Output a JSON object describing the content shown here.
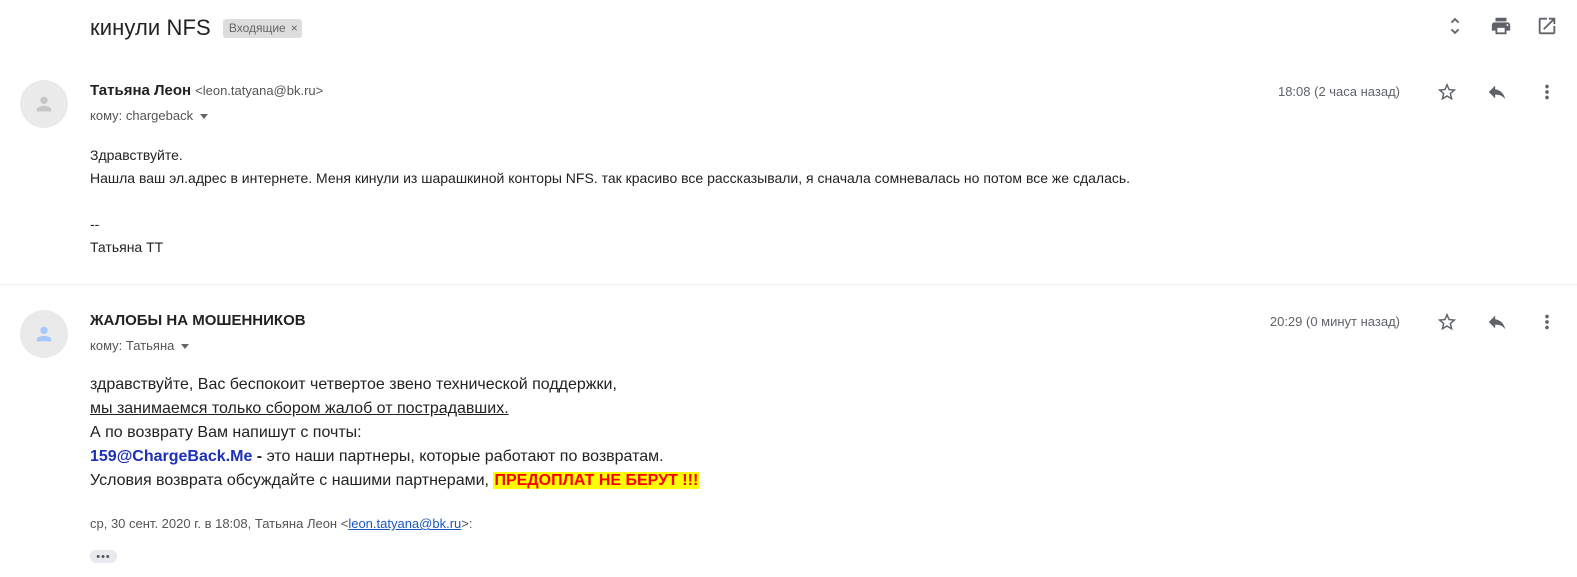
{
  "thread": {
    "subject": "кинули NFS",
    "label": "Входящие",
    "label_remove": "×",
    "top_icons": [
      "expand-collapse-icon",
      "print-icon",
      "open-in-new-window-icon"
    ]
  },
  "messages": [
    {
      "sender_name": "Татьяна Леон",
      "sender_email": "<leon.tatyana@bk.ru>",
      "to": "кому: chargeback",
      "date": "18:08 (2 часа назад)",
      "body": {
        "greeting": "Здравствуйте.",
        "line": "Нашла ваш эл.адрес в интернете. Меня кинули из шарашкиной конторы NFS. так красиво все рассказывали, я сначала сомневалась но потом все же сдалась.",
        "sig_sep": "--",
        "signature": "Татьяна ТТ"
      }
    },
    {
      "sender_name": "ЖАЛОБЫ НА МОШЕННИКОВ",
      "to": "кому: Татьяна",
      "date": "20:29 (0 минут назад)",
      "body": {
        "line1": "здравствуйте, Вас беспокоит четвертое звено технической поддержки,",
        "line2": "мы занимаемся только сбором жалоб от пострадавших.",
        "line3": "А по возврату Вам напишут с почты:",
        "partner_email": "159@ChargeBack.Me",
        "dash": " - ",
        "line4_rest": "это наши партнеры, которые работают по возвратам.",
        "line5": "Условия возврата обсуждайте с нашими партнерами, ",
        "highlight": "ПРЕДОПЛАТ НЕ БЕРУТ !!!"
      },
      "quote": {
        "prefix": "ср, 30 сент. 2020 г. в 18:08, Татьяна Леон <",
        "email": "leon.tatyana@bk.ru",
        "suffix": ">:"
      },
      "show_trimmed": "•••"
    }
  ],
  "colors": {
    "highlight_bg": "#ffff00",
    "highlight_text": "#ff0000",
    "link": "#1c30b8"
  }
}
